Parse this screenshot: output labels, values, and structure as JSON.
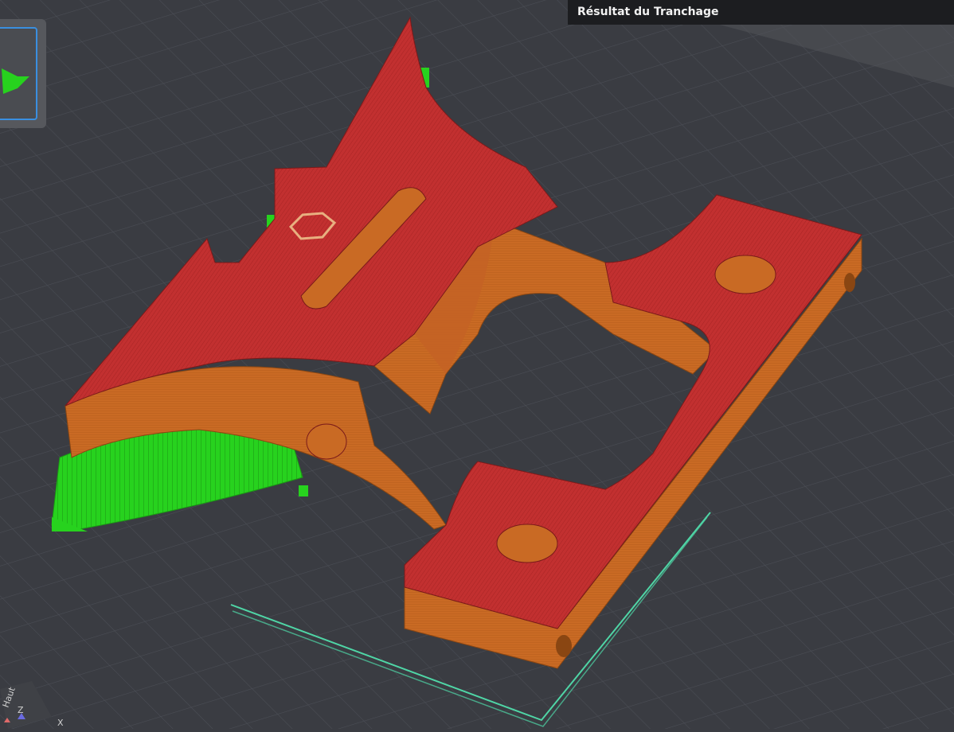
{
  "panel": {
    "title": "Résultat du Tranchage"
  },
  "axes": {
    "view_label": "Haut",
    "z_label": "Z",
    "x_label": "X"
  },
  "icons": {
    "thumbnail": "model-thumbnail-icon",
    "axis": "view-axis-icon"
  },
  "colors": {
    "background": "#3a3c42",
    "grid": "#4b4e56",
    "wall": "#c96a24",
    "top_surface": "#c23030",
    "support": "#27d21e",
    "bed_outline": "#4fd6a6",
    "panel": "#1c1d20"
  }
}
